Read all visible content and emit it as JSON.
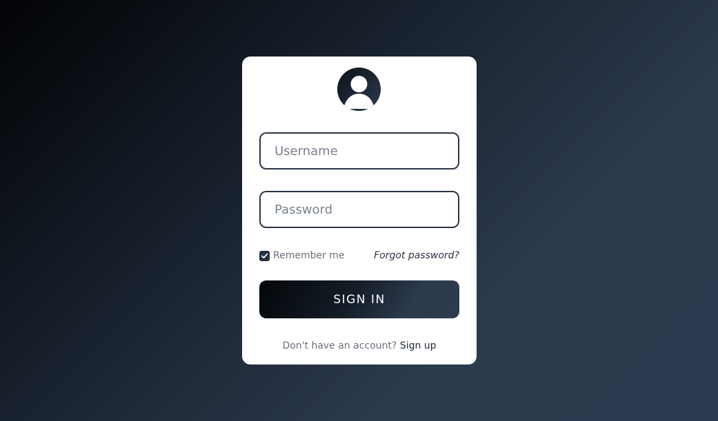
{
  "login": {
    "username_placeholder": "Username",
    "password_placeholder": "Password",
    "remember_label": "Remember me",
    "remember_checked": true,
    "forgot_label": "Forgot password?",
    "signin_label": "SIGN IN",
    "signup_prompt": "Don't have an account?",
    "signup_label": "Sign up"
  },
  "icons": {
    "avatar": "user-avatar-icon",
    "checkbox": "check-icon"
  },
  "colors": {
    "accent_dark": "#0b1118",
    "accent_slate": "#2d3b4e",
    "card_bg": "#ffffff"
  }
}
